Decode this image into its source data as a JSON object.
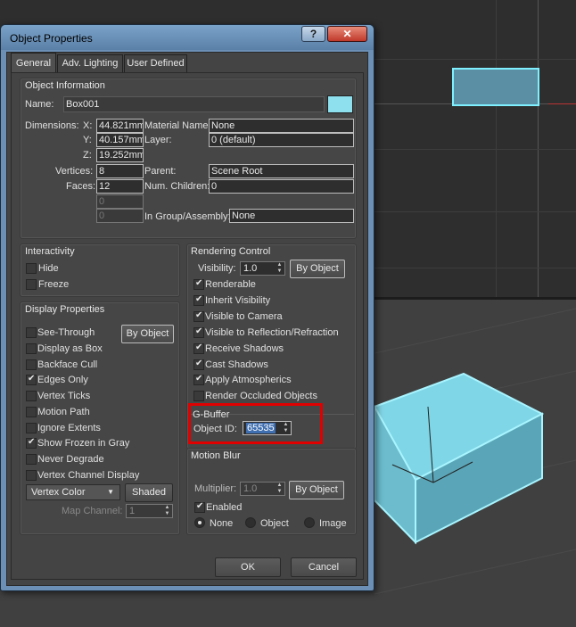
{
  "dialog": {
    "title": "Object Properties",
    "help": "?",
    "close": "✕",
    "tabs": [
      "General",
      "Adv. Lighting",
      "User Defined"
    ]
  },
  "object_info": {
    "title": "Object Information",
    "name_label": "Name:",
    "name_value": "Box001",
    "color": "#8ee0ee",
    "dimensions_label": "Dimensions:",
    "x_label": "X:",
    "x_value": "44.821mm",
    "y_label": "Y:",
    "y_value": "40.157mm",
    "z_label": "Z:",
    "z_value": "19.252mm",
    "vertices_label": "Vertices:",
    "vertices_value": "8",
    "faces_label": "Faces:",
    "faces_value": "12",
    "blank1_value": "0",
    "blank2_value": "0",
    "material_label": "Material Name:",
    "material_value": "None",
    "layer_label": "Layer:",
    "layer_value": "0 (default)",
    "parent_label": "Parent:",
    "parent_value": "Scene Root",
    "children_label": "Num. Children:",
    "children_value": "0",
    "group_label": "In Group/Assembly:",
    "group_value": "None"
  },
  "interactivity": {
    "title": "Interactivity",
    "hide": "Hide",
    "freeze": "Freeze"
  },
  "display": {
    "title": "Display Properties",
    "by_object": "By Object",
    "items": [
      {
        "label": "See-Through",
        "checked": false
      },
      {
        "label": "Display as Box",
        "checked": false
      },
      {
        "label": "Backface Cull",
        "checked": false
      },
      {
        "label": "Edges Only",
        "checked": true
      },
      {
        "label": "Vertex Ticks",
        "checked": false
      },
      {
        "label": "Motion Path",
        "checked": false
      },
      {
        "label": "Ignore Extents",
        "checked": false
      },
      {
        "label": "Show Frozen in Gray",
        "checked": true
      },
      {
        "label": "Never Degrade",
        "checked": false
      },
      {
        "label": "Vertex Channel Display",
        "checked": false
      }
    ],
    "vertex_color": "Vertex Color",
    "shaded": "Shaded",
    "map_channel_label": "Map Channel:",
    "map_channel_value": "1"
  },
  "rendering": {
    "title": "Rendering Control",
    "visibility_label": "Visibility:",
    "visibility_value": "1.0",
    "by_object": "By Object",
    "items": [
      {
        "label": "Renderable",
        "checked": true
      },
      {
        "label": "Inherit Visibility",
        "checked": true
      },
      {
        "label": "Visible to Camera",
        "checked": true
      },
      {
        "label": "Visible to Reflection/Refraction",
        "checked": true
      },
      {
        "label": "Receive Shadows",
        "checked": true
      },
      {
        "label": "Cast Shadows",
        "checked": true
      },
      {
        "label": "Apply Atmospherics",
        "checked": true
      },
      {
        "label": "Render Occluded Objects",
        "checked": false
      }
    ]
  },
  "gbuffer": {
    "title": "G-Buffer",
    "object_id_label": "Object ID:",
    "object_id_value": "65535"
  },
  "motion_blur": {
    "title": "Motion Blur",
    "multiplier_label": "Multiplier:",
    "multiplier_value": "1.0",
    "by_object": "By Object",
    "enabled": "Enabled",
    "none": "None",
    "object": "Object",
    "image": "Image"
  },
  "footer": {
    "ok": "OK",
    "cancel": "Cancel"
  },
  "colors": {
    "highlight": "#8ee0ee",
    "annotation": "#e00000"
  }
}
